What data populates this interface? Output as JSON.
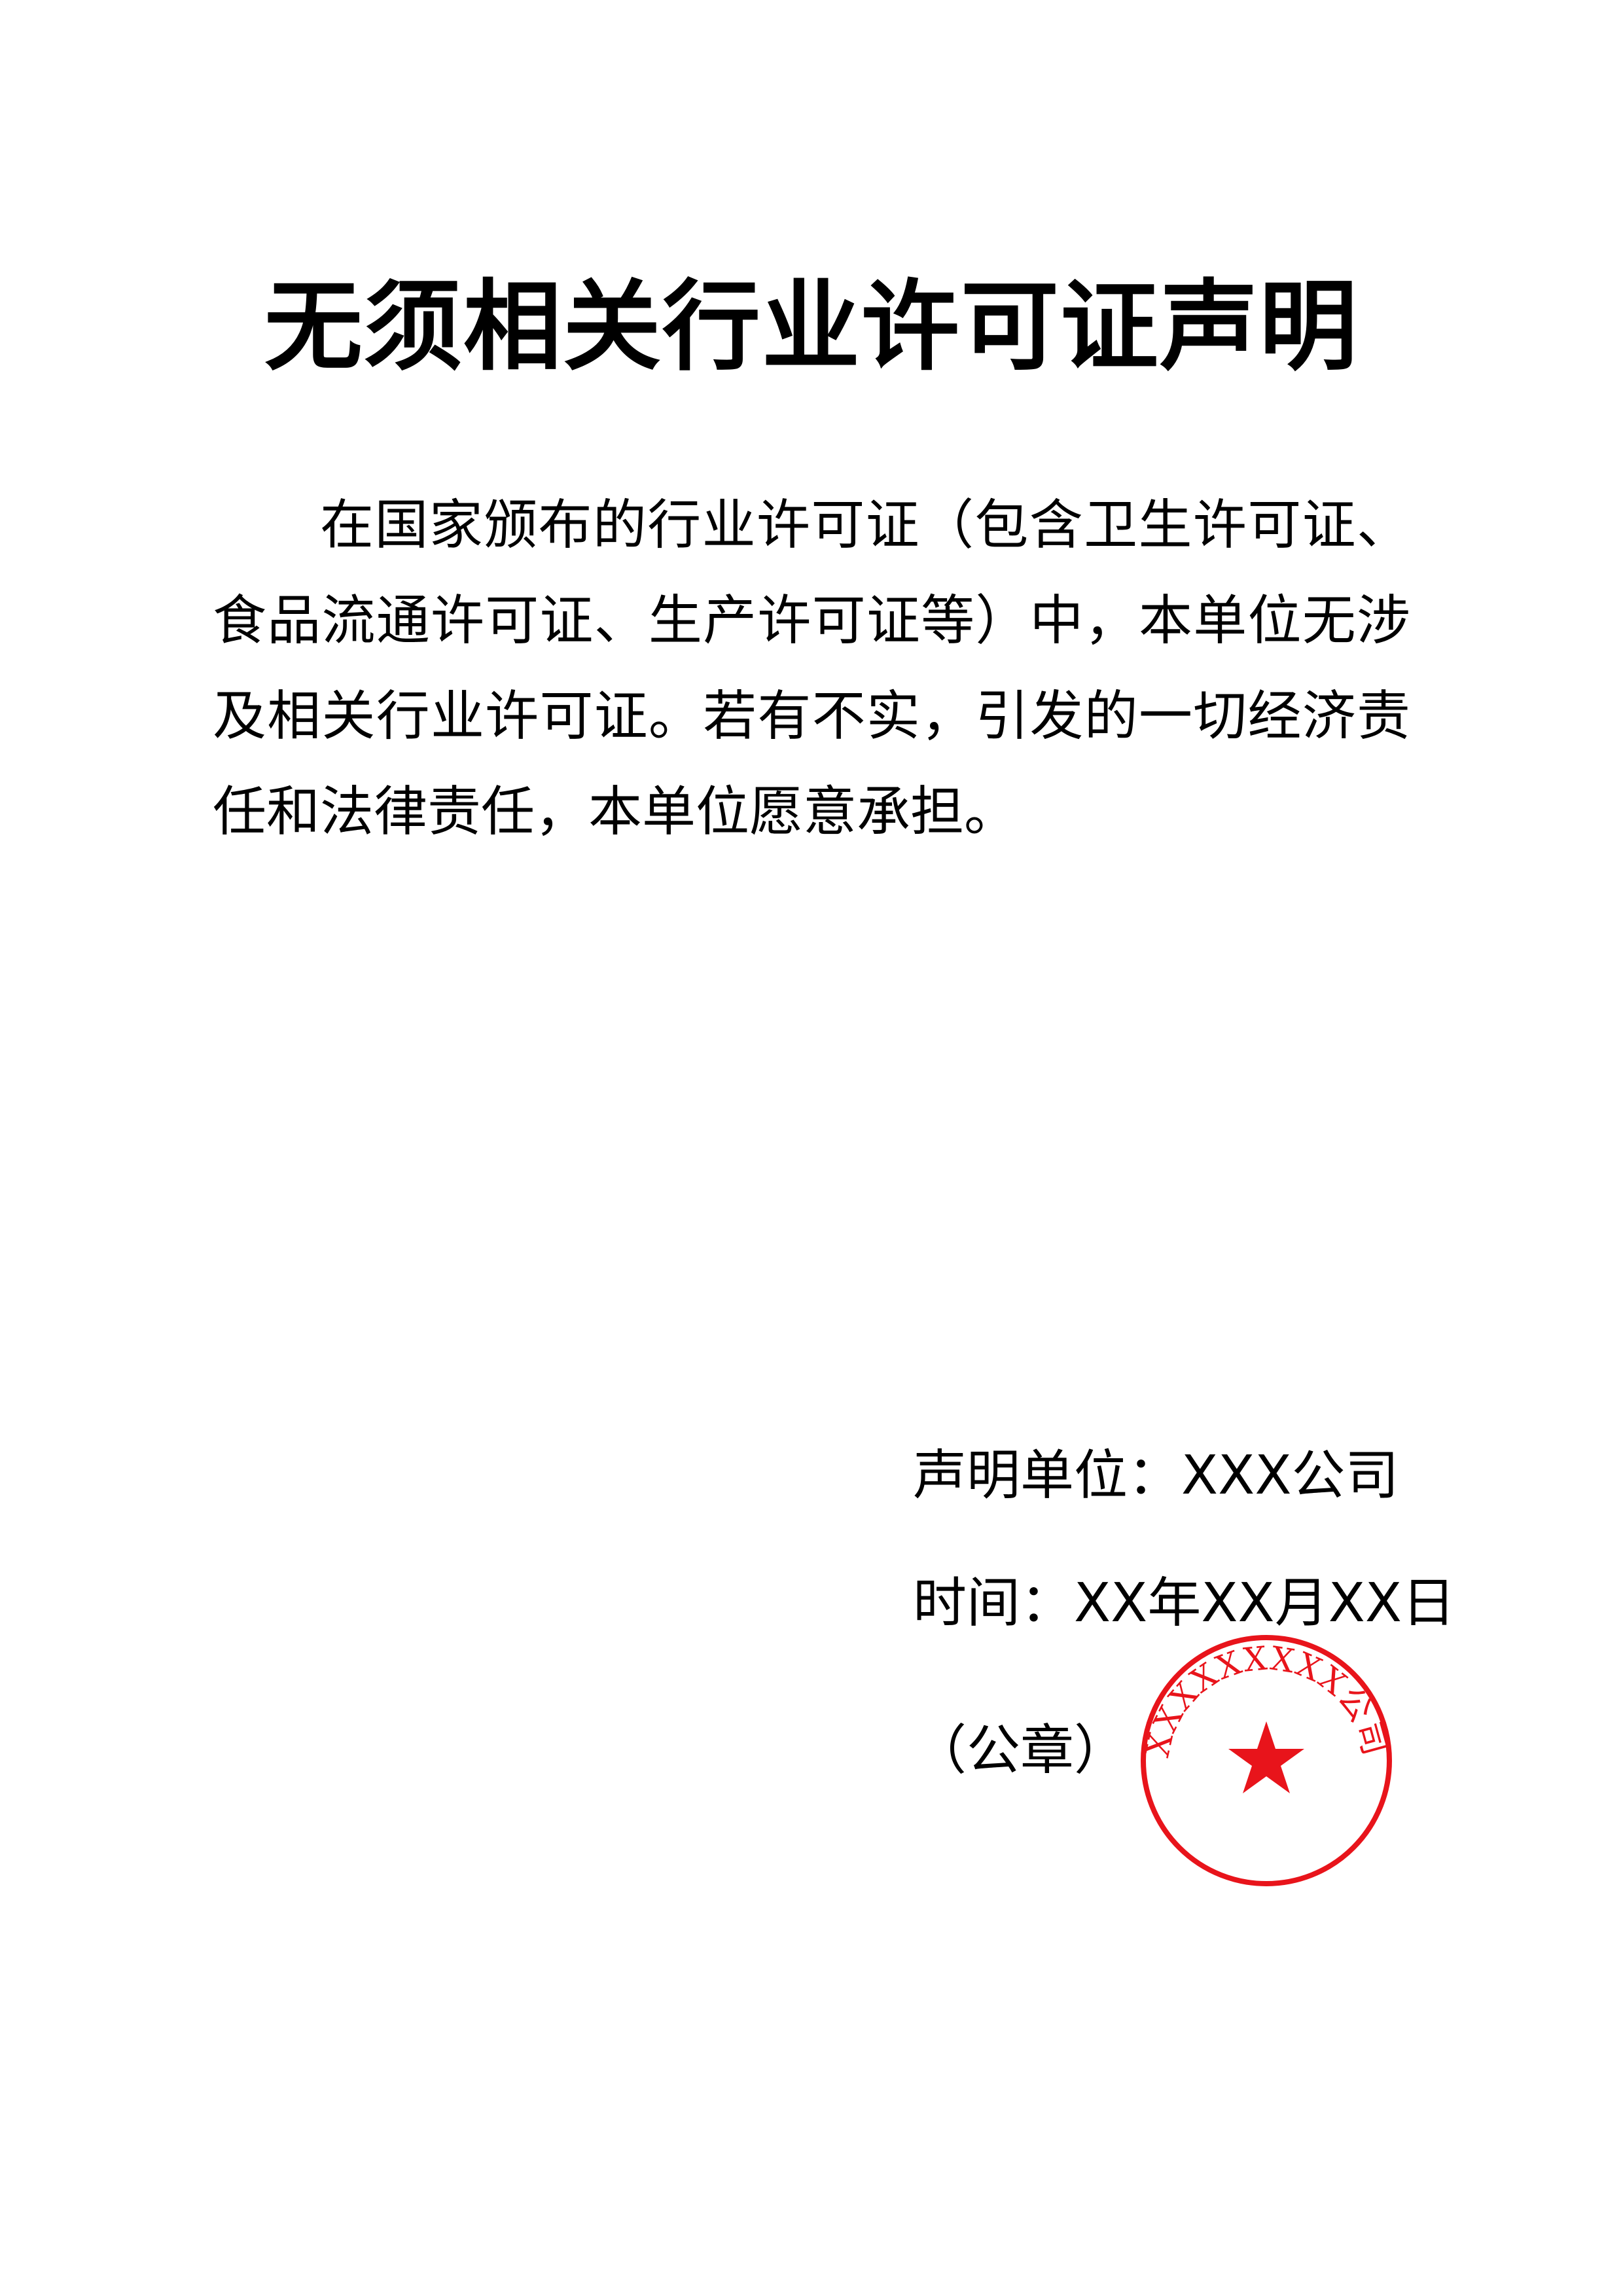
{
  "document": {
    "title": "无须相关行业许可证声明",
    "paragraph": "在国家颁布的行业许可证（包含卫生许可证、食品流通许可证、生产许可证等）中，本单位无涉及相关行业许可证。若有不实，引发的一切经济责任和法律责任，本单位愿意承担。"
  },
  "signature": {
    "unit": "声明单位：XXX公司",
    "date": "时间：XX年XX月XX日",
    "seal_label": "（公章）"
  },
  "seal": {
    "text": "XXXXXXXXX公司",
    "color": "#e8141b",
    "icon": "star-icon"
  }
}
